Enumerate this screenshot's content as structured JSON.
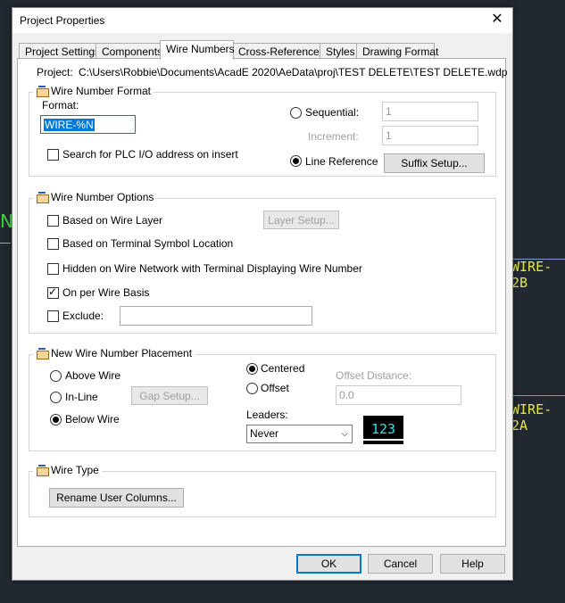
{
  "background": {
    "wire_2b": "WIRE-2B",
    "wire_2a": "WIRE-2A",
    "green_glyph": "N"
  },
  "dialog": {
    "title": "Project Properties",
    "close_glyph": "✕"
  },
  "tabs": [
    {
      "label": "Project Settings"
    },
    {
      "label": "Components"
    },
    {
      "label": "Wire Numbers"
    },
    {
      "label": "Cross-References"
    },
    {
      "label": "Styles"
    },
    {
      "label": "Drawing Format"
    }
  ],
  "active_tab": "Wire Numbers",
  "project": {
    "label": "Project:",
    "path": "C:\\Users\\Robbie\\Documents\\AcadE 2020\\AeData\\proj\\TEST DELETE\\TEST DELETE.wdp"
  },
  "wire_number_format": {
    "title": "Wire Number Format",
    "format_label": "Format:",
    "format_value": "WIRE-%N",
    "sequential_label": "Sequential:",
    "sequential_value": "1",
    "increment_label": "Increment:",
    "increment_value": "1",
    "search_plc_label": "Search for PLC I/O address on insert",
    "search_plc_checked": false,
    "line_reference_label": "Line Reference",
    "line_reference_selected": true,
    "suffix_setup_label": "Suffix Setup..."
  },
  "wire_number_options": {
    "title": "Wire Number Options",
    "based_on_wire_layer": "Based on Wire Layer",
    "layer_setup": "Layer Setup...",
    "based_on_terminal": "Based on Terminal Symbol Location",
    "hidden_on_network": "Hidden on Wire Network with Terminal Displaying Wire Number",
    "on_per_wire": "On per Wire Basis",
    "on_per_wire_checked": true,
    "exclude": "Exclude:",
    "exclude_value": ""
  },
  "placement": {
    "title": "New Wire Number Placement",
    "above_wire": "Above Wire",
    "in_line": "In-Line",
    "gap_setup": "Gap Setup...",
    "below_wire": "Below Wire",
    "below_selected": true,
    "centered": "Centered",
    "centered_selected": true,
    "offset": "Offset",
    "offset_distance_label": "Offset Distance:",
    "offset_distance_value": "0.0",
    "leaders_label": "Leaders:",
    "leaders_value": "Never",
    "preview_text": "123"
  },
  "wire_type": {
    "title": "Wire Type",
    "rename_button": "Rename User Columns..."
  },
  "footer": {
    "ok": "OK",
    "cancel": "Cancel",
    "help": "Help"
  },
  "colors": {
    "cad_background": "#212830",
    "wire_label": "#e6e64a",
    "preview_text": "#33e3e3",
    "default_button_border": "#0078d7"
  }
}
